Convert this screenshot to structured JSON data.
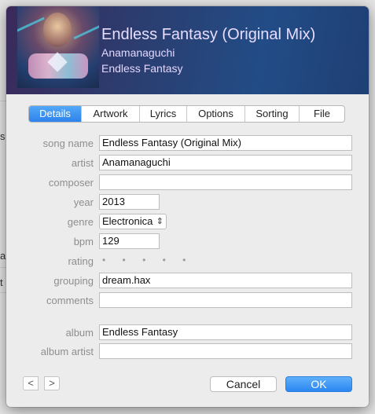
{
  "background": {
    "peek_chars": [
      "s",
      "a",
      "t"
    ]
  },
  "header": {
    "title": "Endless Fantasy (Original Mix)",
    "artist": "Anamanaguchi",
    "album": "Endless Fantasy"
  },
  "tabs": [
    {
      "label": "Details",
      "active": true
    },
    {
      "label": "Artwork"
    },
    {
      "label": "Lyrics"
    },
    {
      "label": "Options"
    },
    {
      "label": "Sorting"
    },
    {
      "label": "File"
    }
  ],
  "fields": {
    "song_name": {
      "label": "song name",
      "value": "Endless Fantasy (Original Mix)"
    },
    "artist": {
      "label": "artist",
      "value": "Anamanaguchi"
    },
    "composer": {
      "label": "composer",
      "value": ""
    },
    "year": {
      "label": "year",
      "value": "2013"
    },
    "genre": {
      "label": "genre",
      "value": "Electronica"
    },
    "bpm": {
      "label": "bpm",
      "value": "129"
    },
    "rating": {
      "label": "rating",
      "value": "• • • • •",
      "stars": 0
    },
    "grouping": {
      "label": "grouping",
      "value": "dream.hax"
    },
    "comments": {
      "label": "comments",
      "value": ""
    },
    "album": {
      "label": "album",
      "value": "Endless Fantasy"
    },
    "album_artist": {
      "label": "album artist",
      "value": ""
    }
  },
  "nav": {
    "prev_glyph": "<",
    "next_glyph": ">"
  },
  "buttons": {
    "cancel": "Cancel",
    "ok": "OK"
  },
  "colors": {
    "accent": "#2d83ec",
    "header": "#224c86",
    "label": "#8e8e8e"
  },
  "icons": {
    "genre_select": "up-down-chevron-icon"
  }
}
